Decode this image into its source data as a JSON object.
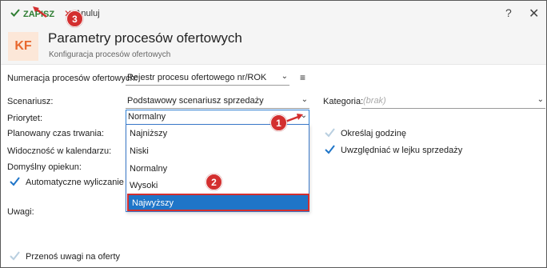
{
  "toolbar": {
    "save_label": "ZAPISZ",
    "cancel_label": "Anuluj",
    "help_label": "?",
    "close_label": "✕"
  },
  "header": {
    "logo": "KF",
    "title": "Parametry procesów ofertowych",
    "subtitle": "Konfiguracja procesów ofertowych"
  },
  "form": {
    "numeracja_label": "Numeracja procesów ofertowych:",
    "numeracja_value": "Rejestr procesu ofertowego nr/ROK",
    "scenariusz_label": "Scenariusz:",
    "scenariusz_value": "Podstawowy scenariusz sprzedaży",
    "kategoria_label": "Kategoria:",
    "kategoria_placeholder": "(brak)",
    "priorytet_label": "Priorytet:",
    "priorytet_value": "Normalny",
    "czas_label": "Planowany czas trwania:",
    "widocznosc_label": "Widoczność w kalendarzu:",
    "opiekun_label": "Domyślny opiekun:",
    "auto_label": "Automatyczne wyliczanie prz",
    "okreslaj_label": "Określaj godzinę",
    "uwzgledniac_label": "Uwzględniać w lejku sprzedaży",
    "uwagi_label": "Uwagi:",
    "przenos_label": "Przenoś uwagi na oferty"
  },
  "dropdown": {
    "options": [
      "Najniższy",
      "Niski",
      "Normalny",
      "Wysoki",
      "Najwyższy"
    ],
    "selected": "Najwyższy"
  },
  "annotations": [
    "1",
    "2",
    "3"
  ],
  "colors": {
    "accent": "#1f75c8",
    "save_green": "#2e7d32",
    "badge_red": "#d32f2f",
    "logo_orange": "#e8682e"
  }
}
